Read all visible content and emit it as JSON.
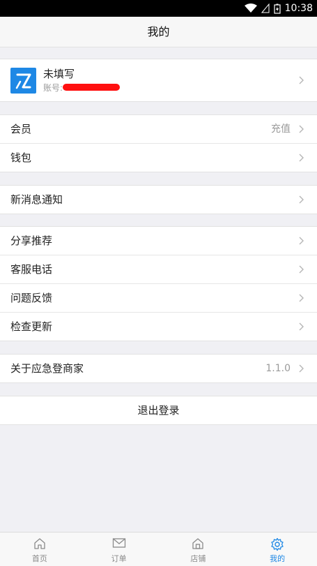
{
  "status": {
    "time": "10:38"
  },
  "header": {
    "title": "我的"
  },
  "profile": {
    "name": "未填写",
    "account_label": "账号:"
  },
  "section1": [
    {
      "label": "会员",
      "value": "充值"
    },
    {
      "label": "钱包",
      "value": ""
    }
  ],
  "section2": [
    {
      "label": "新消息通知",
      "value": ""
    }
  ],
  "section3": [
    {
      "label": "分享推荐"
    },
    {
      "label": "客服电话"
    },
    {
      "label": "问题反馈"
    },
    {
      "label": "检查更新"
    }
  ],
  "section4": [
    {
      "label": "关于应急登商家",
      "value": "1.1.0"
    }
  ],
  "logout_label": "退出登录",
  "tabs": [
    {
      "label": "首页",
      "icon": "home-icon"
    },
    {
      "label": "订单",
      "icon": "mail-icon"
    },
    {
      "label": "店铺",
      "icon": "store-icon"
    },
    {
      "label": "我的",
      "icon": "gear-icon",
      "active": true
    }
  ],
  "colors": {
    "accent": "#1e88e5",
    "background": "#f0f0f4",
    "redaction": "#ff1010"
  }
}
